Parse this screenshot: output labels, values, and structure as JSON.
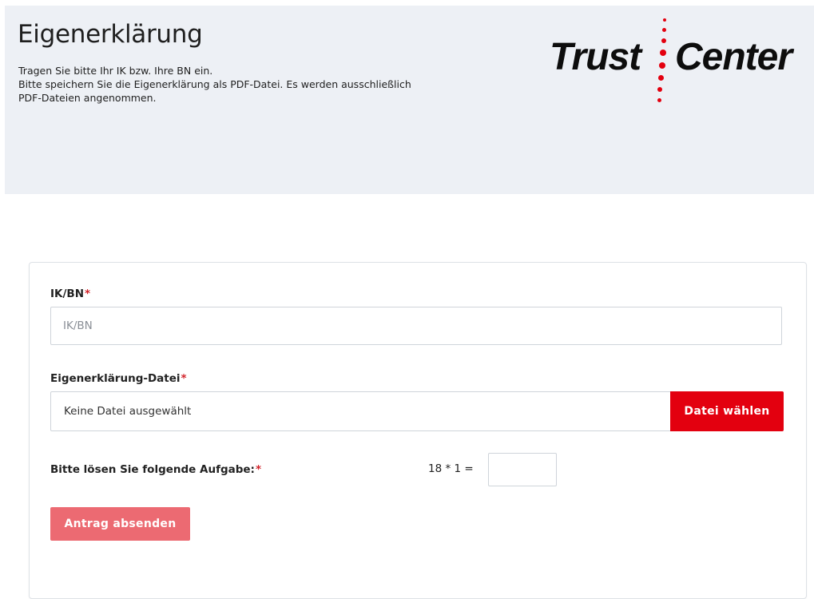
{
  "header": {
    "title": "Eigenerklärung",
    "intro_lines": [
      "Tragen Sie bitte Ihr IK bzw. Ihre BN ein.",
      "Bitte speichern Sie die Eigenerklärung als PDF-Datei. Es werden ausschließlich",
      "PDF-Dateien angenommen."
    ],
    "logo": {
      "word_left": "Trust",
      "word_right": "Center",
      "dot_color": "#e3000f",
      "text_color": "#0d0d0d"
    }
  },
  "form": {
    "ikbn": {
      "label": "IK/BN",
      "required_mark": "*",
      "value": "",
      "placeholder": "IK/BN"
    },
    "file": {
      "label": "Eigenerklärung-Datei",
      "required_mark": "*",
      "status_text": "Keine Datei ausgewählt",
      "button_label": "Datei wählen"
    },
    "captcha": {
      "label": "Bitte lösen Sie folgende Aufgabe:",
      "required_mark": "*",
      "expression": "18 * 1 =",
      "value": ""
    },
    "submit": {
      "label": "Antrag absenden",
      "enabled": false
    }
  },
  "colors": {
    "accent": "#e3000f",
    "submit_disabled": "#ec6a72",
    "header_background": "#edf0f5",
    "required": "#d2232a"
  }
}
